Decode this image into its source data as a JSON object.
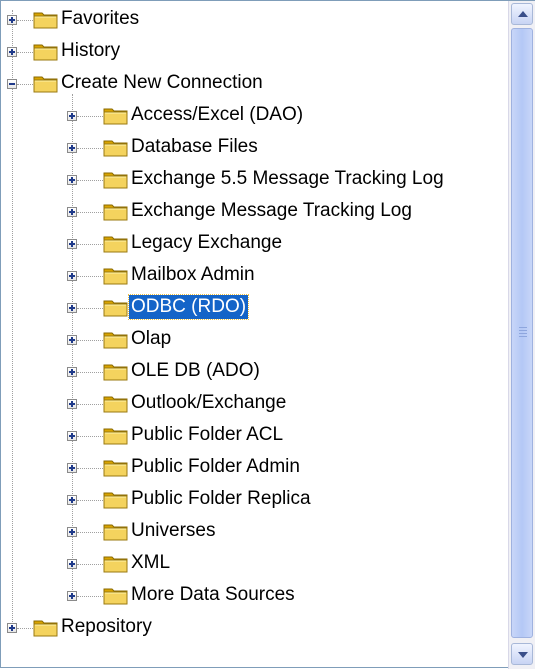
{
  "tree": {
    "items": [
      {
        "label": "Favorites",
        "icon": "folder-icon",
        "expander": "plus"
      },
      {
        "label": "History",
        "icon": "folder-icon",
        "expander": "plus"
      },
      {
        "label": "Create New Connection",
        "icon": "folder-icon",
        "expander": "minus",
        "expanded": true,
        "children": [
          {
            "label": "Access/Excel (DAO)",
            "expander": "plus"
          },
          {
            "label": "Database Files",
            "expander": "plus"
          },
          {
            "label": "Exchange 5.5 Message Tracking Log",
            "expander": "plus"
          },
          {
            "label": "Exchange Message Tracking Log",
            "expander": "plus"
          },
          {
            "label": "Legacy Exchange",
            "expander": "plus"
          },
          {
            "label": "Mailbox Admin",
            "expander": "plus"
          },
          {
            "label": "ODBC (RDO)",
            "expander": "plus",
            "selected": true
          },
          {
            "label": "Olap",
            "expander": "plus"
          },
          {
            "label": "OLE DB (ADO)",
            "expander": "plus"
          },
          {
            "label": "Outlook/Exchange",
            "expander": "plus"
          },
          {
            "label": "Public Folder ACL",
            "expander": "plus"
          },
          {
            "label": "Public Folder Admin",
            "expander": "plus"
          },
          {
            "label": "Public Folder Replica",
            "expander": "plus"
          },
          {
            "label": "Universes",
            "expander": "plus"
          },
          {
            "label": "XML",
            "expander": "plus"
          },
          {
            "label": "More Data Sources",
            "expander": "plus"
          }
        ]
      },
      {
        "label": "Repository",
        "icon": "folder-icon",
        "expander": "plus"
      }
    ]
  },
  "colors": {
    "selection": "#1464c8",
    "folder": "#f4d35e",
    "scrollbar_thumb": "#b4c8f6"
  }
}
